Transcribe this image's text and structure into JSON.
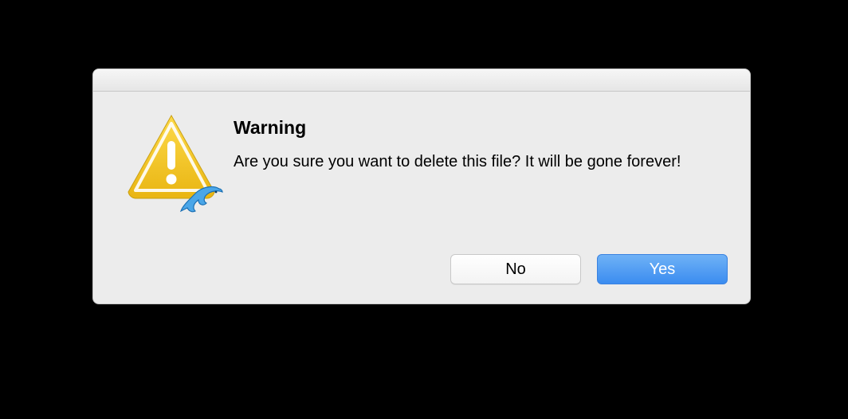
{
  "dialog": {
    "title": "Warning",
    "message": "Are you sure you want to delete this file? It will be gone forever!",
    "icon": "warning-triangle",
    "overlay_icon": "dolphin-app",
    "buttons": {
      "cancel": "No",
      "confirm": "Yes"
    }
  }
}
